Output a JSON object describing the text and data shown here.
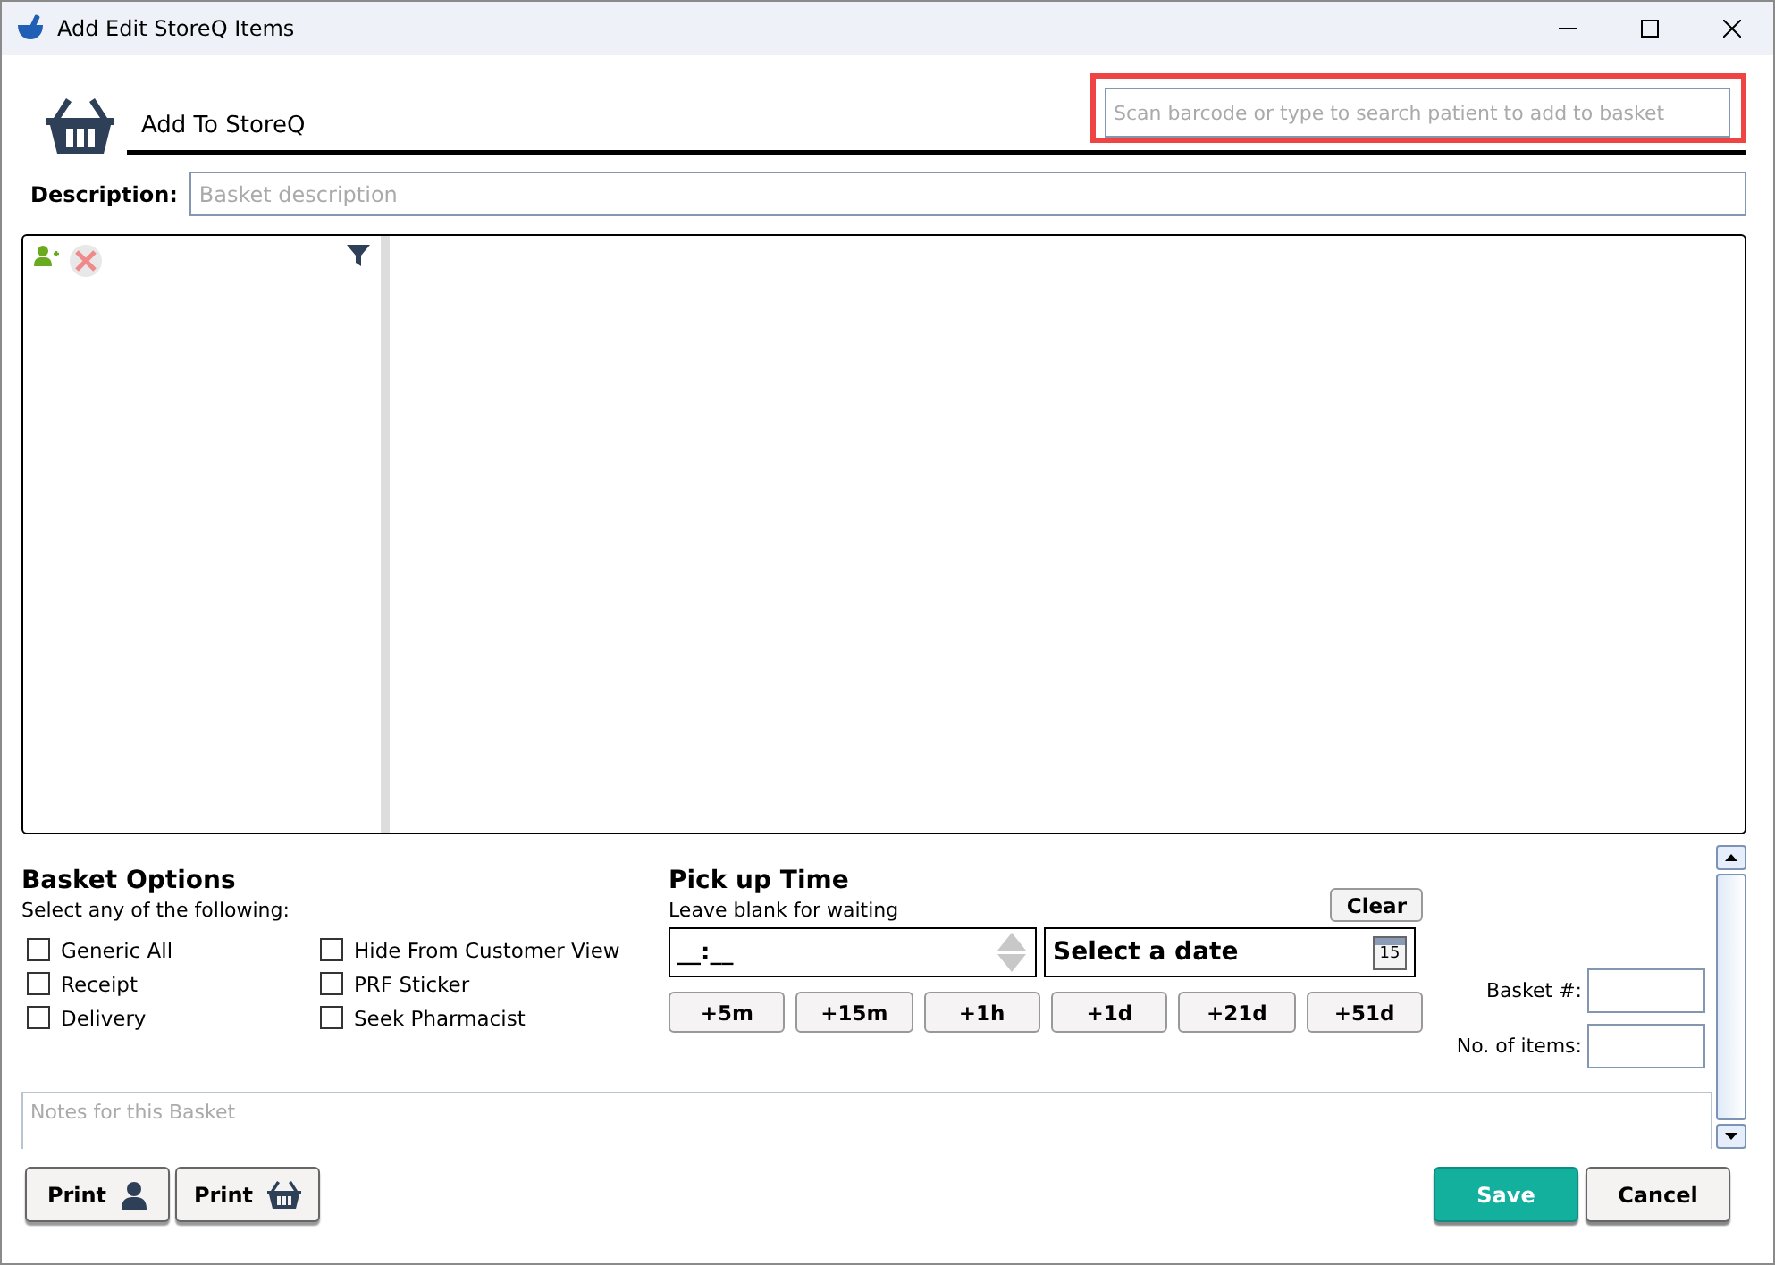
{
  "window": {
    "title": "Add Edit StoreQ Items"
  },
  "header": {
    "title": "Add To StoreQ",
    "search": {
      "placeholder": "Scan barcode or type to search patient to add to basket",
      "highlighted": true
    }
  },
  "description": {
    "label": "Description:",
    "placeholder": "Basket description"
  },
  "basket_options": {
    "title": "Basket Options",
    "subtitle": "Select any of the following:",
    "items": [
      {
        "label": "Generic All",
        "checked": false
      },
      {
        "label": "Receipt",
        "checked": false
      },
      {
        "label": "Delivery",
        "checked": false
      },
      {
        "label": "Hide From Customer View",
        "checked": false
      },
      {
        "label": "PRF Sticker",
        "checked": false
      },
      {
        "label": "Seek Pharmacist",
        "checked": false
      }
    ]
  },
  "pickup": {
    "title": "Pick up Time",
    "subtitle": "Leave blank for waiting",
    "clear": "Clear",
    "time_value": "__:__",
    "date_placeholder": "Select a date",
    "calendar_day": "15",
    "quick_buttons": [
      "+5m",
      "+15m",
      "+1h",
      "+1d",
      "+21d",
      "+51d"
    ]
  },
  "basket_number": {
    "label": "Basket #:"
  },
  "item_count": {
    "label": "No. of items:"
  },
  "notes": {
    "placeholder": "Notes for this Basket"
  },
  "footer": {
    "print_buttons": [
      {
        "label": "Print",
        "kind": "person"
      },
      {
        "label": "Print",
        "kind": "basket"
      }
    ],
    "save": "Save",
    "cancel": "Cancel"
  }
}
